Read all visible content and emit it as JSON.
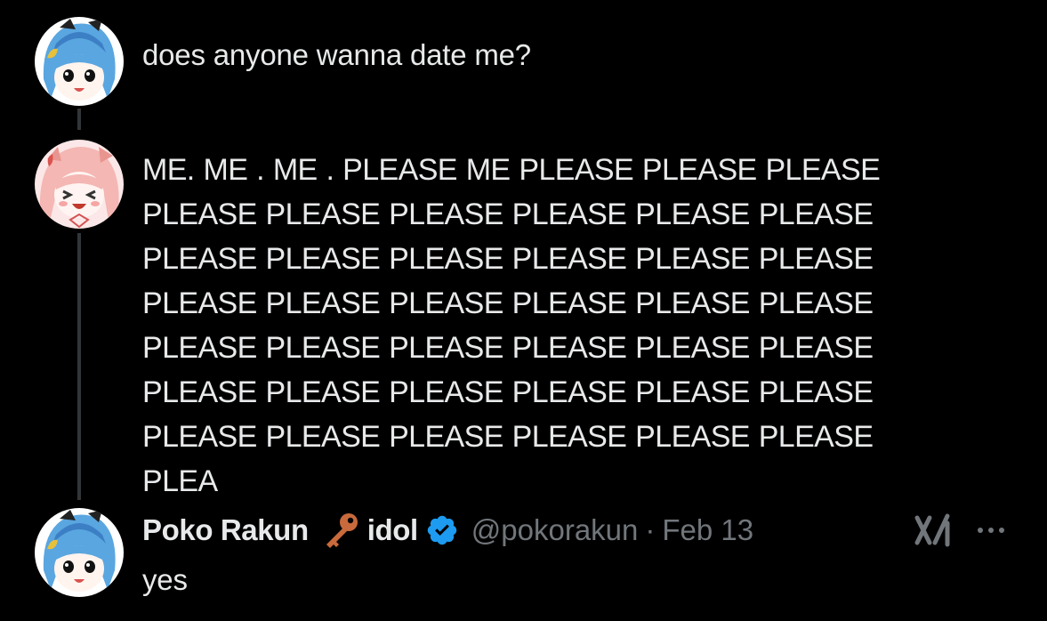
{
  "thread": {
    "post1": {
      "text": "does anyone wanna date me?"
    },
    "post2": {
      "text": "ME. ME . ME . PLEASE ME PLEASE PLEASE PLEASE PLEASE PLEASE PLEASE PLEASE PLEASE PLEASE PLEASE PLEASE PLEASE PLEASE PLEASE PLEASE PLEASE PLEASE PLEASE PLEASE PLEASE PLEASE PLEASE PLEASE PLEASE PLEASE PLEASE PLEASE PLEASE PLEASE PLEASE PLEASE PLEASE PLEASE PLEASE PLEASE PLEASE PLEASE PLEASE PLEASE PLEA"
    },
    "reply": {
      "display_name": "Poko Rakun",
      "name_emoji": "key-icon",
      "role": "idol",
      "verified_badge": "verified-icon",
      "handle": "@pokorakun",
      "separator": "·",
      "date": "Feb 13",
      "text": "yes"
    }
  },
  "actions": {
    "grok": "grok-icon",
    "more": "more-icon"
  },
  "colors": {
    "background": "#000000",
    "text_primary": "#e7e9ea",
    "text_secondary": "#71767b",
    "thread_line": "#333639",
    "verified_blue": "#1d9bf0",
    "key": "#c86a3c"
  }
}
